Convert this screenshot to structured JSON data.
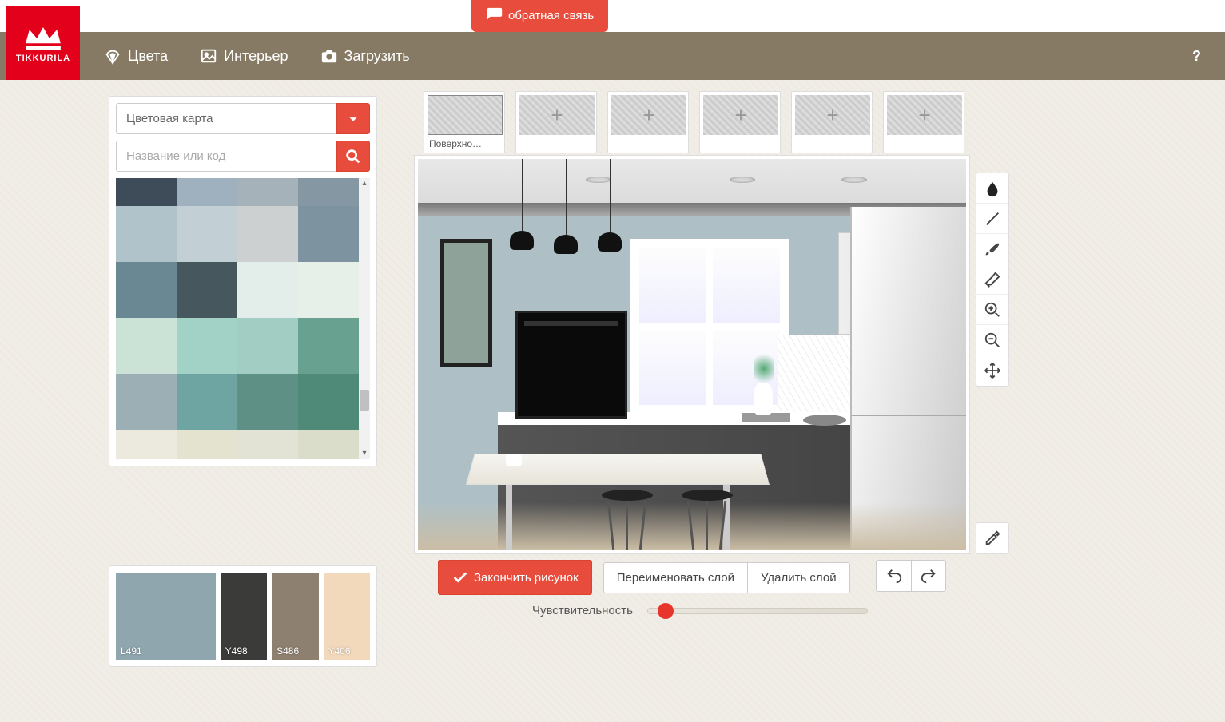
{
  "feedback": {
    "label": "обратная связь"
  },
  "logo": {
    "text": "TIKKURILA"
  },
  "nav": {
    "colors": "Цвета",
    "interior": "Интерьер",
    "upload": "Загрузить",
    "help": "?"
  },
  "palette": {
    "dropdown_label": "Цветовая карта",
    "search_placeholder": "Название или код",
    "swatches": [
      [
        "#3e4b58",
        "#9fb1be",
        "#a5b2b9",
        "#8597a2"
      ],
      [
        "#b0c3ca",
        "#c2cfd4",
        "#ccd0d1",
        "#7e93a0"
      ],
      [
        "#6a8794",
        "#46575e",
        "#e3ede9",
        "#e7efe9"
      ],
      [
        "#cbe2d7",
        "#a1d2c5",
        "#a2cdc3",
        "#68a190"
      ],
      [
        "#9bafb4",
        "#6ea5a3",
        "#5f9085",
        "#4e8a77"
      ],
      [
        "#eceade",
        "#e3e3cf",
        "#e2e3d5",
        "#d9ddc9"
      ],
      [
        "#c2c99c",
        "#a2bd92",
        "#8cb694",
        "#87b79d"
      ]
    ]
  },
  "selected_colors": [
    {
      "code": "L491",
      "hex": "#8fa6ae"
    },
    {
      "code": "Y498",
      "hex": "#3b3b39"
    },
    {
      "code": "S486",
      "hex": "#8d8070"
    },
    {
      "code": "Y406",
      "hex": "#f3d9bc"
    }
  ],
  "surfaces": {
    "first_label": "Поверхно…",
    "add_glyph": "+"
  },
  "tools": {
    "fill": "fill-tool",
    "line": "line-tool",
    "brush": "brush-tool",
    "eraser": "eraser-tool",
    "zoom_in": "zoom-in-tool",
    "zoom_out": "zoom-out-tool",
    "move": "move-tool",
    "eyedropper": "eyedropper-tool"
  },
  "actions": {
    "finish": "Закончить рисунок",
    "rename": "Переименовать слой",
    "delete": "Удалить слой"
  },
  "sensitivity": {
    "label": "Чувствительность",
    "value": 0.04
  }
}
